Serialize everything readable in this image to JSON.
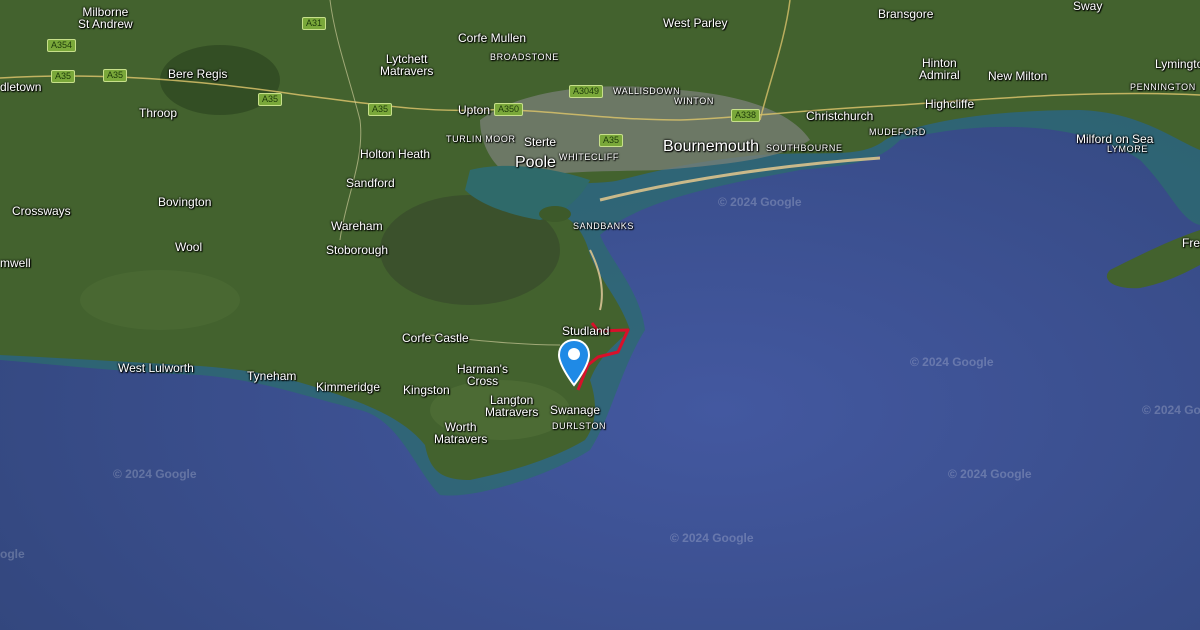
{
  "map": {
    "colors": {
      "sea": "#3b4f8c",
      "land": "#3f5e2c",
      "route": "#d8102a",
      "pin": "#1f8ae6"
    },
    "watermark": "© 2024 Google",
    "places": [
      "Milborne\nSt Andrew",
      "Corfe Mullen",
      "West Parley",
      "Bransgore",
      "Sway",
      "Lytchett\nMatravers",
      "BROADSTONE",
      "Hinton\nAdmiral",
      "Lymington",
      "dletown",
      "Bere Regis",
      "New Milton",
      "PENNINGTON",
      "WALLISDOWN",
      "Throop",
      "Upton",
      "WINTON",
      "Christchurch",
      "Highcliffe",
      "TURLIN MOOR",
      "Sterte",
      "MUDEFORD",
      "Milford on Sea",
      "Holton Heath",
      "Poole",
      "WHITECLIFF",
      "Bournemouth",
      "SOUTHBOURNE",
      "LYMORE",
      "Sandford",
      "Crossways",
      "Bovington",
      "SANDBANKS",
      "Wareham",
      "Fre",
      "Wool",
      "Stoborough",
      "mwell",
      "Studland",
      "Corfe Castle",
      "West Lulworth",
      "Harman's\nCross",
      "Tyneham",
      "Kimmeridge",
      "Kingston",
      "Langton\nMatravers",
      "Swanage",
      "DURLSTON",
      "Worth\nMatravers"
    ],
    "roads": [
      "A31",
      "A354",
      "A35",
      "A35",
      "A35",
      "A35",
      "A350",
      "A3049",
      "A35",
      "A338"
    ],
    "pin_label": "location-marker"
  }
}
